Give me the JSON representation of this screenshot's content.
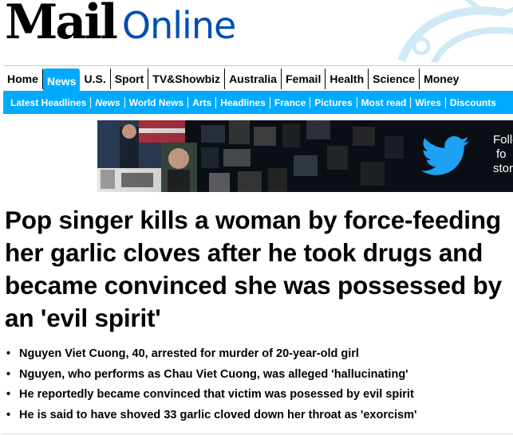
{
  "brand": {
    "logo_mail": "Mail",
    "logo_online": "Online",
    "accent_color": "#00aaff",
    "online_color": "#004db3"
  },
  "primary_nav": {
    "items": [
      "Home",
      "News",
      "U.S.",
      "Sport",
      "TV&Showbiz",
      "Australia",
      "Femail",
      "Health",
      "Science",
      "Money"
    ],
    "active": "News"
  },
  "secondary_nav": {
    "items": [
      "Latest Headlines",
      "News",
      "World News",
      "Arts",
      "Headlines",
      "France",
      "Pictures",
      "Most read",
      "Wires",
      "Discounts"
    ],
    "italic_item": "News"
  },
  "banner": {
    "text_lines": [
      "Follo",
      "fo",
      "stor"
    ],
    "icon": "twitter-bird-icon",
    "icon_color": "#1da1f2"
  },
  "article": {
    "headline": "Pop singer kills a woman by force-feeding her garlic cloves after he took drugs and became convinced she was possessed by an 'evil spirit'",
    "bullets": [
      "Nguyen Viet Cuong, 40, arrested for murder of 20-year-old girl",
      "Nguyen, who performs as Chau Viet Cuong, was alleged 'hallucinating'",
      "He reportedly became convinced that victim was posessed by evil spirit",
      "He is said to have shoved 33 garlic cloved down her throat as 'exorcism'"
    ]
  }
}
